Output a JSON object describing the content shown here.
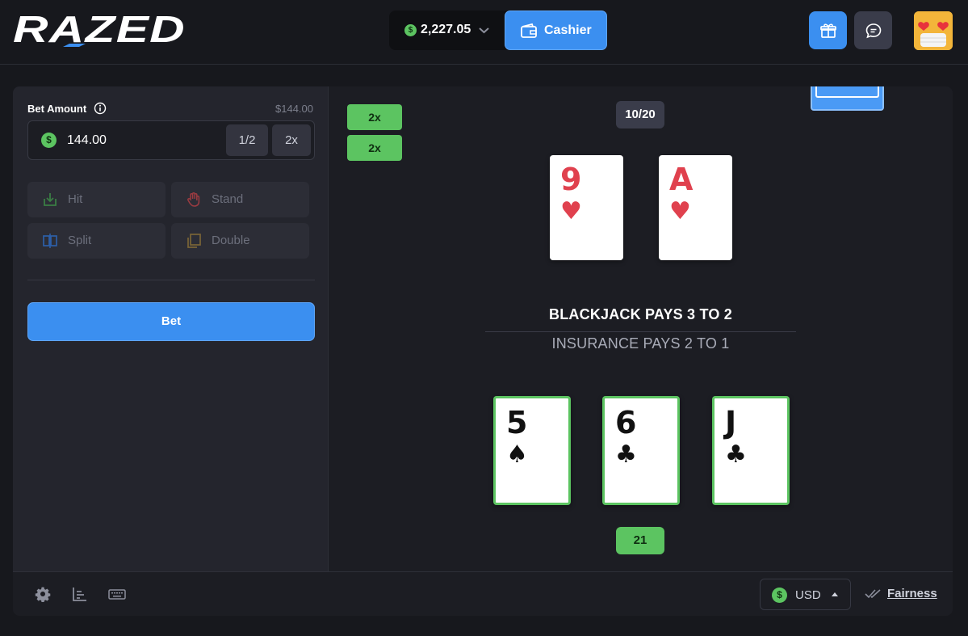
{
  "header": {
    "logo_text": "RAZED",
    "wallet": {
      "balance": "2,227.05",
      "currency_symbol": "$"
    },
    "cashier_label": "Cashier",
    "colors": {
      "accent": "#3b8ff0",
      "coin": "#5cc461"
    }
  },
  "sidebar": {
    "bet_amount_label": "Bet Amount",
    "bet_amount_usd": "$144.00",
    "bet_value": "144.00",
    "half_label": "1/2",
    "double_label": "2x",
    "actions": [
      {
        "label": "Hit",
        "icon": "hit-icon"
      },
      {
        "label": "Stand",
        "icon": "stand-hand-icon"
      },
      {
        "label": "Split",
        "icon": "split-icon"
      },
      {
        "label": "Double",
        "icon": "double-icon"
      }
    ],
    "bet_button_label": "Bet"
  },
  "game": {
    "side_multipliers": [
      "2x",
      "2x"
    ],
    "dealer_score": "10/20",
    "dealer_cards": [
      {
        "rank": "9",
        "suit": "♥",
        "color": "red"
      },
      {
        "rank": "A",
        "suit": "♥",
        "color": "red"
      }
    ],
    "rules_primary": "BLACKJACK PAYS 3 TO 2",
    "rules_secondary": "INSURANCE PAYS 2 TO 1",
    "player_cards": [
      {
        "rank": "5",
        "suit": "♠",
        "color": "black"
      },
      {
        "rank": "6",
        "suit": "♣",
        "color": "black"
      },
      {
        "rank": "J",
        "suit": "♣",
        "color": "black"
      }
    ],
    "player_score": "21"
  },
  "footer": {
    "currency_label": "USD",
    "fairness_label": "Fairness"
  }
}
